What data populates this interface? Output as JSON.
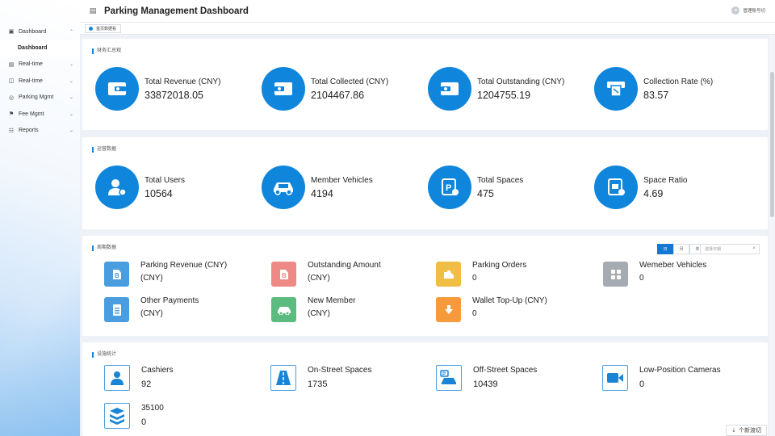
{
  "header": {
    "title": "Parking Management Dashboard",
    "user_label": "管理账号切",
    "menu_icon": "menu-icon"
  },
  "tabs": [
    {
      "label": "首页数据看"
    }
  ],
  "sidebar": {
    "items": [
      {
        "label": "Dashboard",
        "icon": "dashboard-icon",
        "expanded": true
      },
      {
        "label": "Dashboard",
        "sub": true,
        "active": true
      },
      {
        "label": "Real-time",
        "icon": "realtime-icon"
      },
      {
        "label": "Real-time",
        "icon": "monitor-icon"
      },
      {
        "label": "Parking Mgmt",
        "icon": "parking-icon"
      },
      {
        "label": "Fee Mgmt",
        "icon": "fee-icon"
      },
      {
        "label": "Reports",
        "icon": "reports-icon"
      }
    ]
  },
  "overview": {
    "title": "财务汇总观",
    "stats": [
      {
        "label": "Total Revenue (CNY)",
        "value": "33872018.05",
        "icon": "wallet-icon"
      },
      {
        "label": "Total Collected (CNY)",
        "value": "2104467.86",
        "icon": "wallet-icon"
      },
      {
        "label": "Total Outstanding (CNY)",
        "value": "1204755.19",
        "icon": "wallet-icon"
      },
      {
        "label": "Collection Rate (%)",
        "value": "83.57",
        "icon": "receipt-icon"
      }
    ]
  },
  "operations": {
    "title": "运营数据",
    "stats": [
      {
        "label": "Total Users",
        "value": "10564",
        "icon": "user-icon"
      },
      {
        "label": "Member Vehicles",
        "value": "4194",
        "icon": "car-icon"
      },
      {
        "label": "Total Spaces",
        "value": "475",
        "icon": "parking-space-icon"
      },
      {
        "label": "Space Ratio",
        "value": "4.69",
        "icon": "ratio-icon"
      }
    ]
  },
  "period": {
    "title": "周期数据",
    "filters": [
      {
        "label": "日",
        "active": true
      },
      {
        "label": "月",
        "active": false
      },
      {
        "label": "年",
        "active": false
      }
    ],
    "date_placeholder": "选择日期",
    "stats": [
      {
        "label": "Parking Revenue (CNY)",
        "value": "(CNY)",
        "icon": "revenue-icon",
        "color": "#4a9ee0"
      },
      {
        "label": "Outstanding Amount",
        "value": "(CNY)",
        "icon": "arrears-icon",
        "color": "#ee8a86"
      },
      {
        "label": "Parking Orders",
        "value": "0",
        "icon": "order-icon",
        "color": "#f0be45"
      },
      {
        "label": "Wemeber Vehicles",
        "value": "0",
        "icon": "grid-icon",
        "color": "#a6abb2"
      },
      {
        "label": "Other Payments",
        "value": "(CNY)",
        "icon": "document-icon",
        "color": "#4a9ee0"
      },
      {
        "label": "New Member",
        "value": "(CNY)",
        "icon": "car-icon",
        "color": "#5cbc80"
      },
      {
        "label": "Wallet Top-Up (CNY)",
        "value": "0",
        "icon": "download-icon",
        "color": "#f79a3c"
      }
    ]
  },
  "facilities": {
    "title": "设施统计",
    "stats": [
      {
        "label": "Cashiers",
        "value": "92",
        "icon": "cashier-icon"
      },
      {
        "label": "On-Street Spaces",
        "value": "1735",
        "icon": "road-icon"
      },
      {
        "label": "Off-Street Spaces",
        "value": "10439",
        "icon": "garage-icon"
      },
      {
        "label": "Low-Position Cameras",
        "value": "0",
        "icon": "camera-icon"
      },
      {
        "label": "35100",
        "value": "0",
        "icon": "server-icon"
      }
    ]
  },
  "float_button": {
    "label": "个新渡切"
  },
  "colors": {
    "primary": "#0f86dc",
    "active_tab": "#1677d2"
  }
}
